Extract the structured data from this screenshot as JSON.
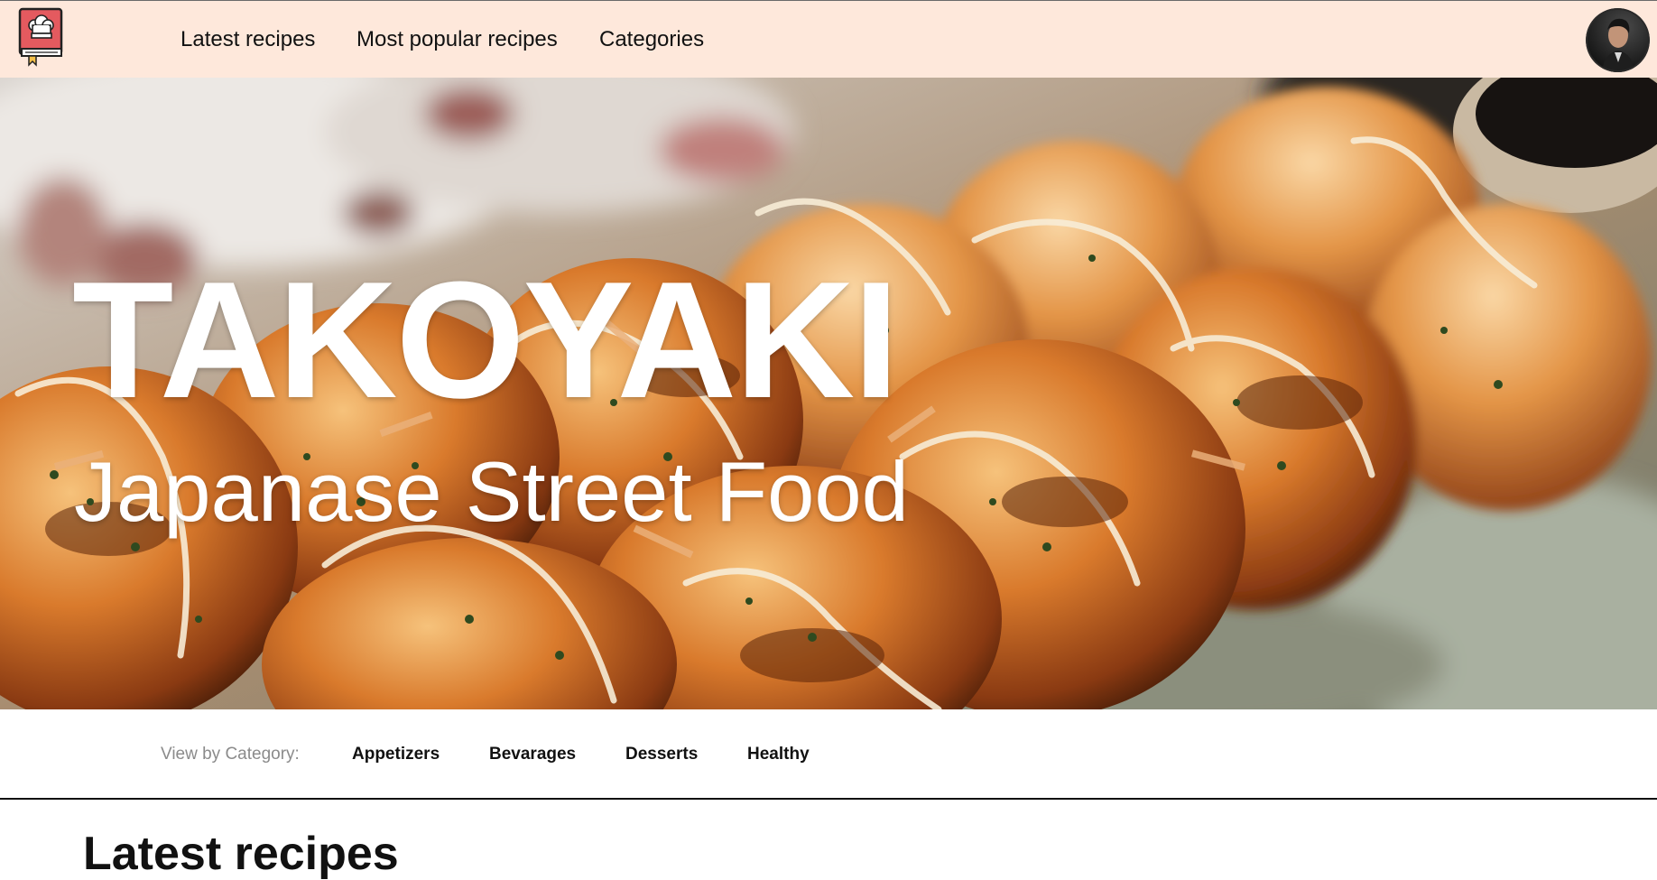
{
  "nav": {
    "logo_icon": "chef-hat-book-icon",
    "links": [
      "Latest recipes",
      "Most popular recipes",
      "Categories"
    ],
    "avatar_icon": "user-avatar"
  },
  "hero": {
    "title": "TAKOYAKI",
    "subtitle": "Japanase Street Food"
  },
  "category_bar": {
    "label": "View by Category:",
    "categories": [
      "Appetizers",
      "Bevarages",
      "Desserts",
      "Healthy"
    ]
  },
  "latest": {
    "heading": "Latest recipes"
  },
  "colors": {
    "nav_bg": "#fee8db",
    "logo_red": "#e45a5f",
    "text_dark": "#111111",
    "muted_label": "#8b8b8b"
  }
}
